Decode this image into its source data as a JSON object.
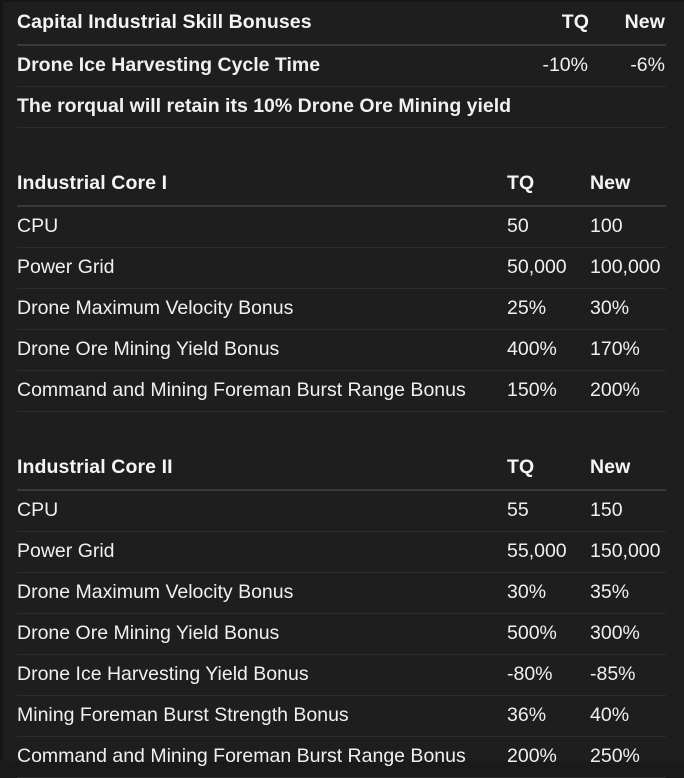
{
  "theme": {
    "background": "#1e1e1e",
    "text": "#f0f0f0",
    "header_rule": "#3a3a3a",
    "row_rule": "#2c2c2c"
  },
  "tables": [
    {
      "id": "capital-industrial-skill-bonuses",
      "title": "Capital Industrial Skill Bonuses",
      "columns": [
        "TQ",
        "New"
      ],
      "rows": [
        {
          "label": "Drone Ice Harvesting Cycle Time",
          "tq": "-10%",
          "new": "-6%"
        },
        {
          "label": "The rorqual will retain its 10% Drone Ore Mining yield",
          "tq": "",
          "new": "",
          "span": true
        }
      ]
    },
    {
      "id": "industrial-core-i",
      "title": "Industrial Core I",
      "columns": [
        "TQ",
        "New"
      ],
      "rows": [
        {
          "label": "CPU",
          "tq": "50",
          "new": "100"
        },
        {
          "label": "Power Grid",
          "tq": "50,000",
          "new": "100,000"
        },
        {
          "label": "Drone Maximum Velocity Bonus",
          "tq": "25%",
          "new": "30%"
        },
        {
          "label": "Drone Ore Mining Yield Bonus",
          "tq": "400%",
          "new": "170%"
        },
        {
          "label": "Command and Mining Foreman Burst Range Bonus",
          "tq": "150%",
          "new": "200%"
        }
      ]
    },
    {
      "id": "industrial-core-ii",
      "title": "Industrial Core II",
      "columns": [
        "TQ",
        "New"
      ],
      "rows": [
        {
          "label": "CPU",
          "tq": "55",
          "new": "150"
        },
        {
          "label": "Power Grid",
          "tq": "55,000",
          "new": "150,000"
        },
        {
          "label": "Drone Maximum Velocity Bonus",
          "tq": "30%",
          "new": "35%"
        },
        {
          "label": "Drone Ore Mining Yield Bonus",
          "tq": "500%",
          "new": "300%"
        },
        {
          "label": "Drone Ice Harvesting Yield Bonus",
          "tq": "-80%",
          "new": "-85%"
        },
        {
          "label": "Mining Foreman Burst Strength Bonus",
          "tq": "36%",
          "new": "40%"
        },
        {
          "label": "Command and Mining Foreman Burst Range Bonus",
          "tq": "200%",
          "new": "250%"
        }
      ]
    }
  ]
}
